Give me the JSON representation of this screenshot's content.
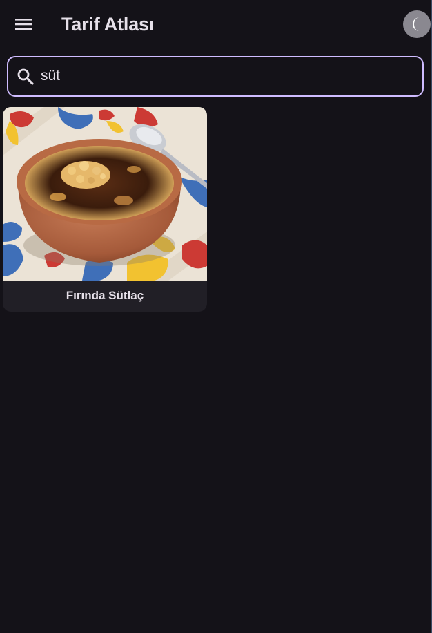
{
  "app_bar": {
    "title": "Tarif Atlası",
    "menu_icon": "menu-icon",
    "theme_icon": "dark-mode-icon"
  },
  "search": {
    "value": "süt",
    "icon": "search-icon",
    "accent_color": "#cfbcff"
  },
  "results": [
    {
      "title": "Fırında Sütlaç",
      "image": "rice-pudding-in-clay-bowl"
    }
  ],
  "colors": {
    "background": "#141218",
    "surface": "#211f26",
    "on_surface": "#e6e0e9",
    "accent": "#cfbcff"
  }
}
